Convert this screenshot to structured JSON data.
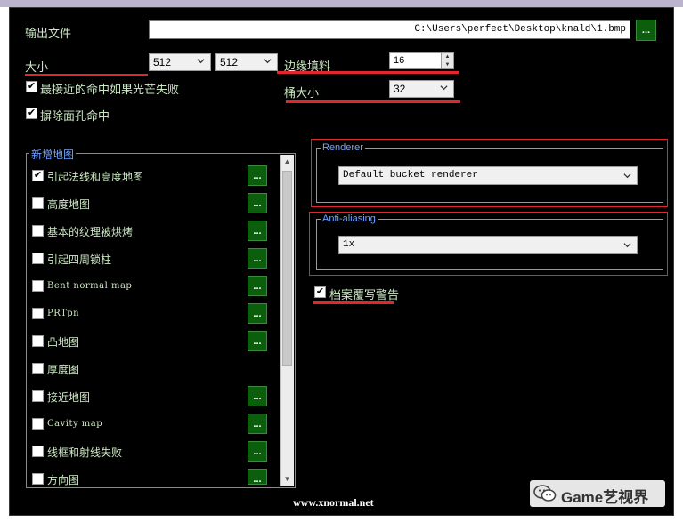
{
  "output_file": {
    "label": "输出文件",
    "path": "C:\\Users\\perfect\\Desktop\\knald\\1.bmp",
    "browse_label": "..."
  },
  "size": {
    "label": "大小",
    "width_value": "512",
    "height_value": "512"
  },
  "edge_padding": {
    "label": "边缘填料",
    "value": "16"
  },
  "bucket_size": {
    "label": "桶大小",
    "value": "32"
  },
  "options": [
    {
      "label": "最接近的命中如果光芒失败",
      "checked": true
    },
    {
      "label": "摒除面孔命中",
      "checked": true
    }
  ],
  "maps_group": {
    "title": "新增地图",
    "items": [
      {
        "label": "引起法线和高度地图",
        "checked": true,
        "has_button": true
      },
      {
        "label": "高度地图",
        "checked": false,
        "has_button": true
      },
      {
        "label": "基本的纹理被烘烤",
        "checked": false,
        "has_button": true
      },
      {
        "label": "引起四周锁柱",
        "checked": false,
        "has_button": true
      },
      {
        "label": "Bent normal map",
        "checked": false,
        "has_button": true
      },
      {
        "label": "PRTpn",
        "checked": false,
        "has_button": true
      },
      {
        "label": "凸地图",
        "checked": false,
        "has_button": true
      },
      {
        "label": "厚度图",
        "checked": false,
        "has_button": false
      },
      {
        "label": "接近地图",
        "checked": false,
        "has_button": true
      },
      {
        "label": "Cavity map",
        "checked": false,
        "has_button": true
      },
      {
        "label": "线框和射线失败",
        "checked": false,
        "has_button": true
      },
      {
        "label": "方向图",
        "checked": false,
        "has_button": true
      }
    ],
    "button_label": "..."
  },
  "renderer": {
    "title": "Renderer",
    "value": "Default bucket renderer"
  },
  "anti_aliasing": {
    "title": "Anti-aliasing",
    "value": "1x"
  },
  "overwrite_warning": {
    "label": "档案覆写警告",
    "checked": true
  },
  "watermark": {
    "site": "www.xnormal.net",
    "brand": "Game艺视界"
  },
  "colors": {
    "background": "#000000",
    "text": "#cde8c4",
    "group_title": "#6fa3ff",
    "button": "#0b5e0b",
    "annotation": "#e3262e"
  },
  "icons": {
    "check": "checkmark-icon",
    "dropdown": "chevron-down-icon",
    "wechat": "wechat-logo-icon"
  }
}
